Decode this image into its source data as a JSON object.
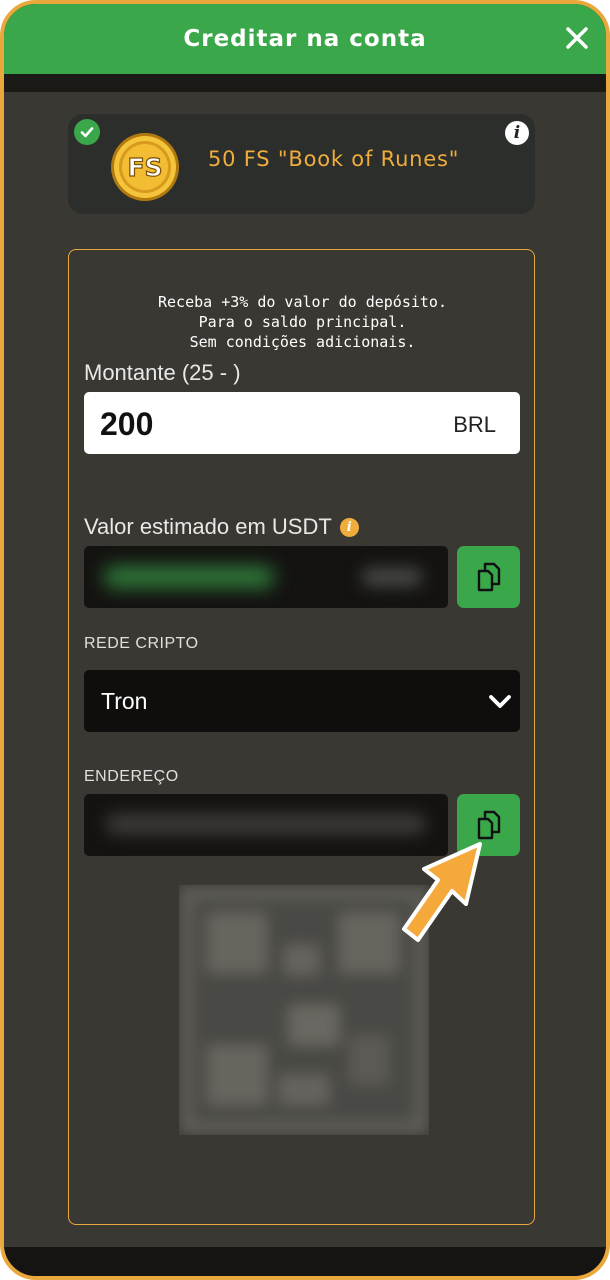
{
  "header": {
    "title": "Creditar na conta",
    "close_icon": "close-icon"
  },
  "bonus": {
    "badge_icon": "check-icon",
    "info_icon": "info-icon",
    "info_glyph": "i",
    "coin_icon": "fs-coin-icon",
    "coin_text": "FS",
    "text": "50 FS \"Book of Runes\""
  },
  "form": {
    "promo_lines": [
      "Receba +3% do valor do depósito.",
      "Para o saldo principal.",
      "Sem condições adicionais."
    ],
    "amount": {
      "label": "Montante (25 - )",
      "value": "200",
      "currency": "BRL"
    },
    "estimate": {
      "label": "Valor estimado em USDT",
      "info_glyph": "i",
      "copy_icon": "copy-icon"
    },
    "network": {
      "label": "REDE CRIPTO",
      "selected": "Tron",
      "chevron_icon": "chevron-down-icon"
    },
    "address": {
      "label": "ENDEREÇO",
      "copy_icon": "copy-icon"
    },
    "qr_icon": "qr-code"
  },
  "overlay": {
    "pointer_icon": "pointing-arrow-icon"
  },
  "colors": {
    "accent_green": "#3aa84a",
    "accent_orange": "#f0ad3c",
    "border": "#e9a83c",
    "panel": "#3a3833"
  }
}
